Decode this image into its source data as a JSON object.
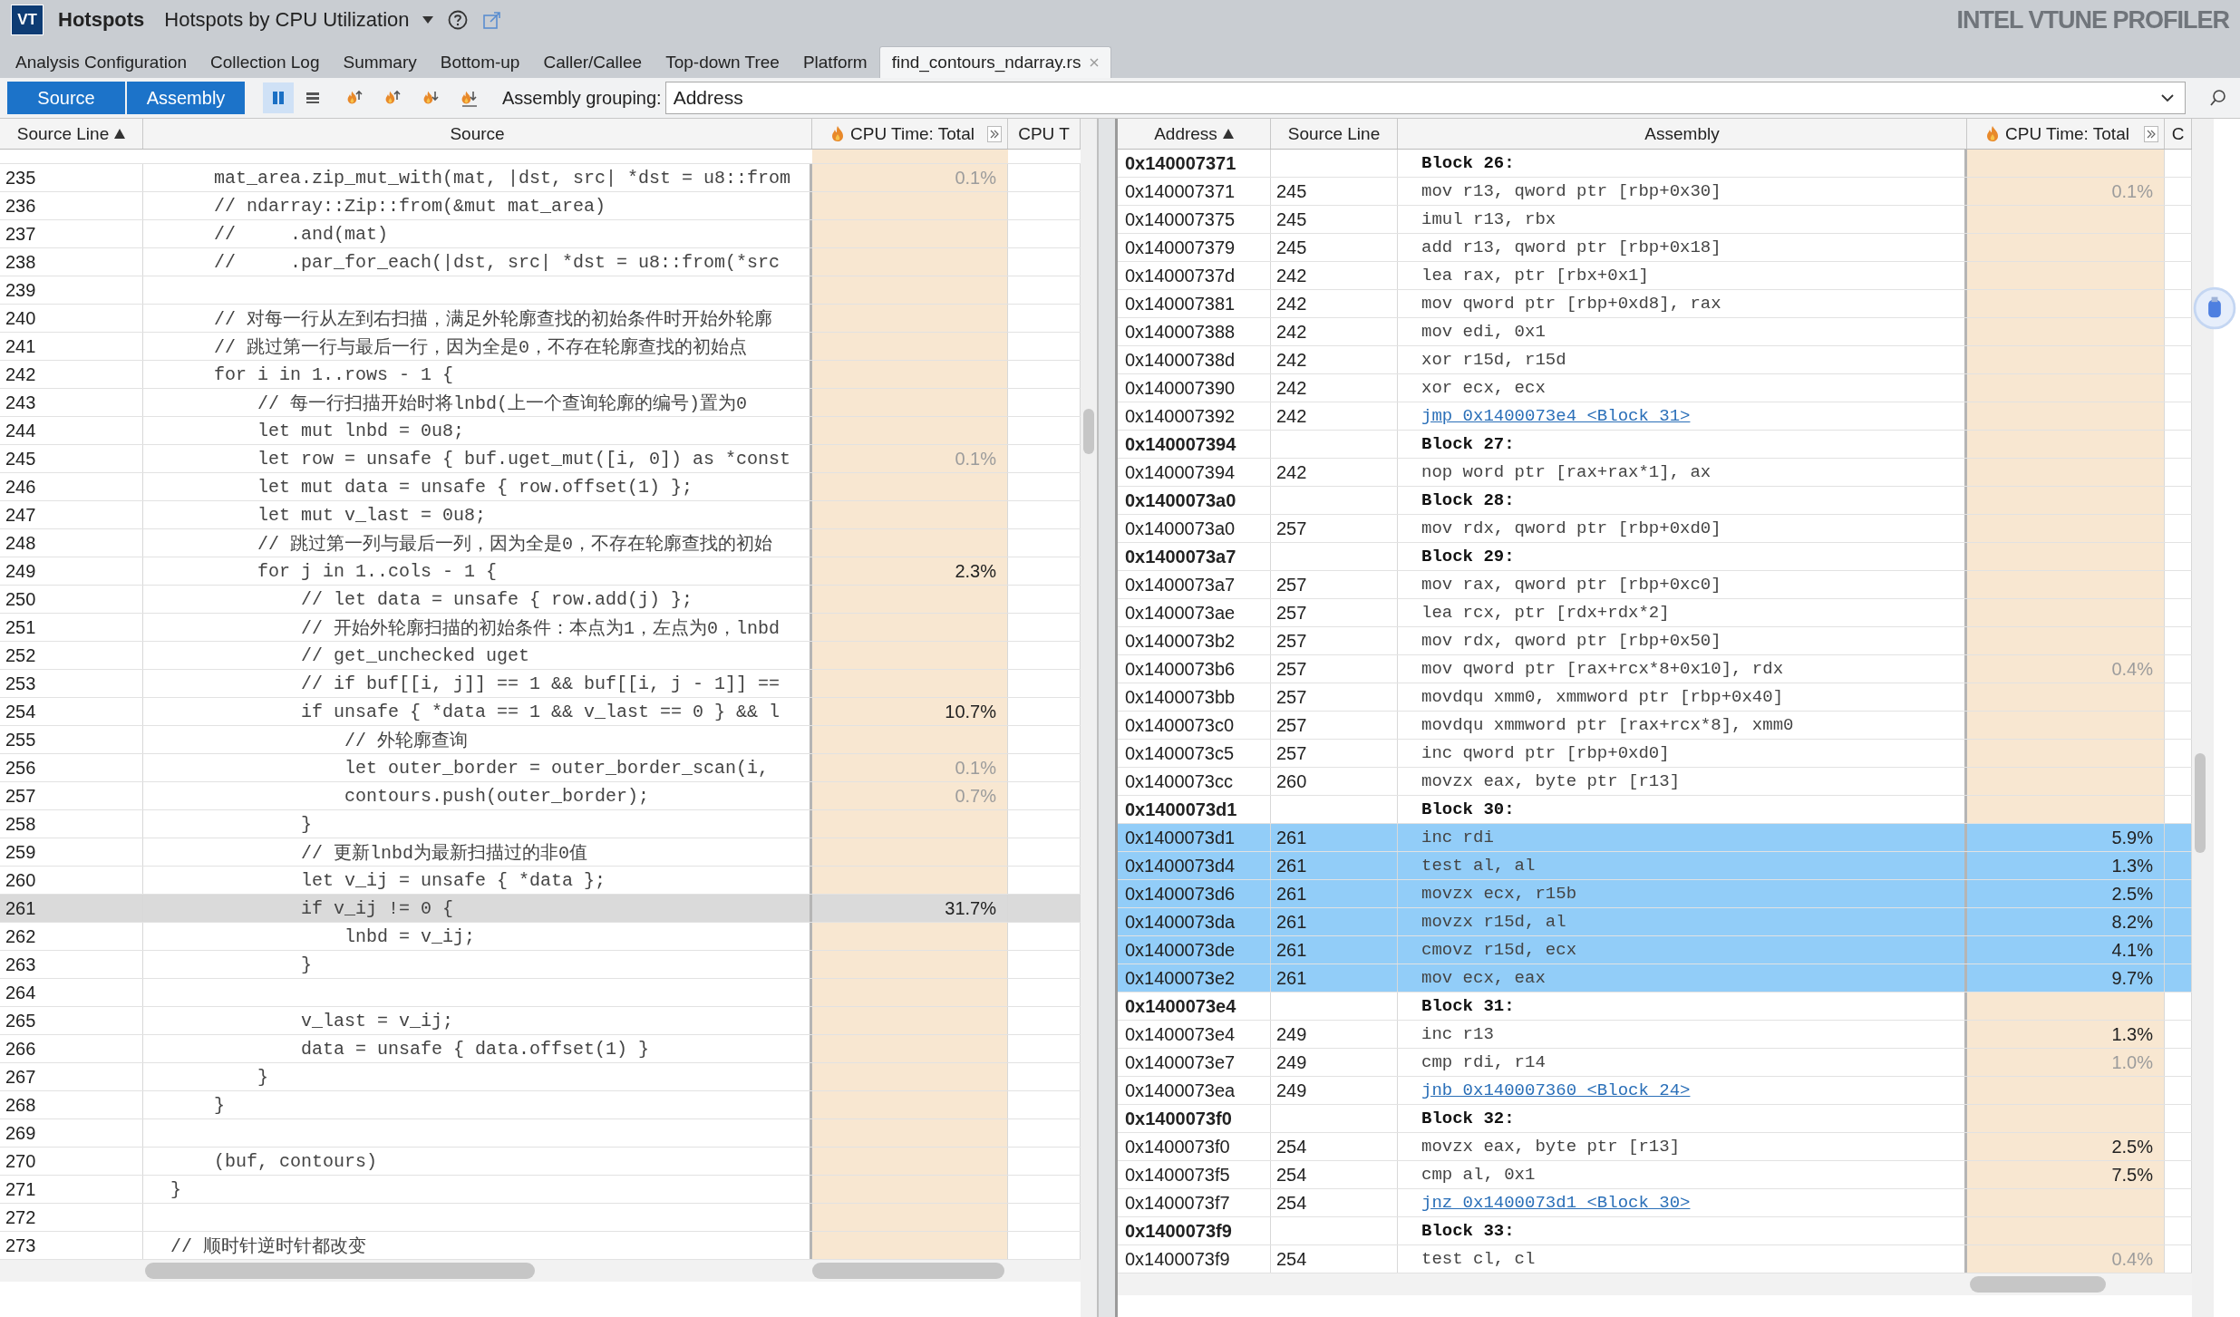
{
  "app": {
    "logo": "VT",
    "name": "Hotspots",
    "viewpoint": "Hotspots by CPU Utilization",
    "brand": "INTEL VTUNE PROFILER"
  },
  "tabs": [
    {
      "label": "Analysis Configuration",
      "selected": false,
      "closable": false
    },
    {
      "label": "Collection Log",
      "selected": false,
      "closable": false
    },
    {
      "label": "Summary",
      "selected": false,
      "closable": false
    },
    {
      "label": "Bottom-up",
      "selected": false,
      "closable": false
    },
    {
      "label": "Caller/Callee",
      "selected": false,
      "closable": false
    },
    {
      "label": "Top-down Tree",
      "selected": false,
      "closable": false
    },
    {
      "label": "Platform",
      "selected": false,
      "closable": false
    },
    {
      "label": "find_contours_ndarray.rs",
      "selected": true,
      "closable": true
    }
  ],
  "toolbar": {
    "views": [
      {
        "label": "Source",
        "selected": true
      },
      {
        "label": "Assembly",
        "selected": true
      }
    ],
    "layout_toggles": [
      {
        "kind": "columns",
        "selected": true
      },
      {
        "kind": "rows",
        "selected": false
      }
    ],
    "grouping": {
      "label": "Assembly grouping:",
      "value": "Address"
    }
  },
  "source_pane": {
    "columns": [
      {
        "label": "Source Line",
        "sorted": true,
        "kind": "plain"
      },
      {
        "label": "Source",
        "sorted": false,
        "kind": "plain"
      },
      {
        "label": "CPU Time: Total",
        "sorted": false,
        "kind": "metric"
      },
      {
        "label": "CPU T",
        "sorted": false,
        "kind": "plain"
      }
    ],
    "rows": [
      {
        "line": "235",
        "code": "    mat_area.zip_mut_with(mat, |dst, src| *dst = u8::from",
        "cpu": "0.1%",
        "faint": true,
        "selected": false
      },
      {
        "line": "236",
        "code": "    // ndarray::Zip::from(&mut mat_area)",
        "selected": false
      },
      {
        "line": "237",
        "code": "    //     .and(mat)",
        "selected": false
      },
      {
        "line": "238",
        "code": "    //     .par_for_each(|dst, src| *dst = u8::from(*src",
        "selected": false
      },
      {
        "line": "239",
        "selected": false
      },
      {
        "line": "240",
        "code": "    // 对每一行从左到右扫描，满足外轮廓查找的初始条件时开始外轮廓",
        "selected": false
      },
      {
        "line": "241",
        "code": "    // 跳过第一行与最后一行，因为全是0，不存在轮廓查找的初始点",
        "selected": false
      },
      {
        "line": "242",
        "code": "    for i in 1..rows - 1 {",
        "selected": false
      },
      {
        "line": "243",
        "code": "        // 每一行扫描开始时将lnbd(上一个查询轮廓的编号)置为0",
        "selected": false
      },
      {
        "line": "244",
        "code": "        let mut lnbd = 0u8;",
        "selected": false
      },
      {
        "line": "245",
        "code": "        let row = unsafe { buf.uget_mut([i, 0]) as *const",
        "cpu": "0.1%",
        "faint": true,
        "selected": false
      },
      {
        "line": "246",
        "code": "        let mut data = unsafe { row.offset(1) };",
        "selected": false
      },
      {
        "line": "247",
        "code": "        let mut v_last = 0u8;",
        "selected": false
      },
      {
        "line": "248",
        "code": "        // 跳过第一列与最后一列，因为全是0，不存在轮廓查找的初始",
        "selected": false
      },
      {
        "line": "249",
        "code": "        for j in 1..cols - 1 {",
        "cpu": "2.3%",
        "faint": false,
        "selected": false
      },
      {
        "line": "250",
        "code": "            // let data = unsafe { row.add(j) };",
        "selected": false
      },
      {
        "line": "251",
        "code": "            // 开始外轮廓扫描的初始条件：本点为1，左点为0，lnbd",
        "selected": false
      },
      {
        "line": "252",
        "code": "            // get_unchecked uget",
        "selected": false
      },
      {
        "line": "253",
        "code": "            // if buf[[i, j]] == 1 && buf[[i, j - 1]] ==",
        "selected": false
      },
      {
        "line": "254",
        "code": "            if unsafe { *data == 1 && v_last == 0 } && l",
        "cpu": "10.7%",
        "faint": false,
        "selected": false
      },
      {
        "line": "255",
        "code": "                // 外轮廓查询",
        "selected": false
      },
      {
        "line": "256",
        "code": "                let outer_border = outer_border_scan(i,",
        "cpu": "0.1%",
        "faint": true,
        "selected": false
      },
      {
        "line": "257",
        "code": "                contours.push(outer_border);",
        "cpu": "0.7%",
        "faint": true,
        "selected": false
      },
      {
        "line": "258",
        "code": "            }",
        "selected": false
      },
      {
        "line": "259",
        "code": "            // 更新lnbd为最新扫描过的非0值",
        "selected": false
      },
      {
        "line": "260",
        "code": "            let v_ij = unsafe { *data };",
        "selected": false
      },
      {
        "line": "261",
        "code": "            if v_ij != 0 {",
        "cpu": "31.7%",
        "faint": false,
        "selected": true
      },
      {
        "line": "262",
        "code": "                lnbd = v_ij;",
        "selected": false
      },
      {
        "line": "263",
        "code": "            }",
        "selected": false
      },
      {
        "line": "264",
        "selected": false
      },
      {
        "line": "265",
        "code": "            v_last = v_ij;",
        "selected": false
      },
      {
        "line": "266",
        "code": "            data = unsafe { data.offset(1) }",
        "selected": false
      },
      {
        "line": "267",
        "code": "        }",
        "selected": false
      },
      {
        "line": "268",
        "code": "    }",
        "selected": false
      },
      {
        "line": "269",
        "selected": false
      },
      {
        "line": "270",
        "code": "    (buf, contours)",
        "selected": false
      },
      {
        "line": "271",
        "code": "}",
        "selected": false
      },
      {
        "line": "272",
        "selected": false
      },
      {
        "line": "273",
        "code": "// 顺时针逆时针都改变",
        "selected": false
      }
    ]
  },
  "assembly_pane": {
    "columns": [
      {
        "label": "Address",
        "sorted": true,
        "kind": "plain"
      },
      {
        "label": "Source Line",
        "sorted": false,
        "kind": "plain"
      },
      {
        "label": "Assembly",
        "sorted": false,
        "kind": "plain"
      },
      {
        "label": "CPU Time: Total",
        "sorted": false,
        "kind": "metric"
      },
      {
        "label": "C",
        "sorted": false,
        "kind": "plain"
      }
    ],
    "rows": [
      {
        "kind": "block",
        "address": "0x140007371",
        "assembly": "Block 26:",
        "selected": false
      },
      {
        "kind": "instr",
        "address": "0x140007371",
        "line": "245",
        "assembly": "mov r13, qword ptr [rbp+0x30]",
        "cpu": "0.1%",
        "faint": true,
        "selected": false
      },
      {
        "kind": "instr",
        "address": "0x140007375",
        "line": "245",
        "assembly": "imul r13, rbx",
        "selected": false
      },
      {
        "kind": "instr",
        "address": "0x140007379",
        "line": "245",
        "assembly": "add r13, qword ptr [rbp+0x18]",
        "selected": false
      },
      {
        "kind": "instr",
        "address": "0x14000737d",
        "line": "242",
        "assembly": "lea rax, ptr [rbx+0x1]",
        "selected": false
      },
      {
        "kind": "instr",
        "address": "0x140007381",
        "line": "242",
        "assembly": "mov qword ptr [rbp+0xd8], rax",
        "selected": false
      },
      {
        "kind": "instr",
        "address": "0x140007388",
        "line": "242",
        "assembly": "mov edi, 0x1",
        "selected": false
      },
      {
        "kind": "instr",
        "address": "0x14000738d",
        "line": "242",
        "assembly": "xor r15d, r15d",
        "selected": false
      },
      {
        "kind": "instr",
        "address": "0x140007390",
        "line": "242",
        "assembly": "xor ecx, ecx",
        "selected": false
      },
      {
        "kind": "jump",
        "address": "0x140007392",
        "line": "242",
        "assembly": "jmp 0x1400073e4 <Block 31>",
        "selected": false
      },
      {
        "kind": "block",
        "address": "0x140007394",
        "assembly": "Block 27:",
        "selected": false
      },
      {
        "kind": "instr",
        "address": "0x140007394",
        "line": "242",
        "assembly": "nop word ptr [rax+rax*1], ax",
        "selected": false
      },
      {
        "kind": "block",
        "address": "0x1400073a0",
        "assembly": "Block 28:",
        "selected": false
      },
      {
        "kind": "instr",
        "address": "0x1400073a0",
        "line": "257",
        "assembly": "mov rdx, qword ptr [rbp+0xd0]",
        "selected": false
      },
      {
        "kind": "block",
        "address": "0x1400073a7",
        "assembly": "Block 29:",
        "selected": false
      },
      {
        "kind": "instr",
        "address": "0x1400073a7",
        "line": "257",
        "assembly": "mov rax, qword ptr [rbp+0xc0]",
        "selected": false
      },
      {
        "kind": "instr",
        "address": "0x1400073ae",
        "line": "257",
        "assembly": "lea rcx, ptr [rdx+rdx*2]",
        "selected": false
      },
      {
        "kind": "instr",
        "address": "0x1400073b2",
        "line": "257",
        "assembly": "mov rdx, qword ptr [rbp+0x50]",
        "selected": false
      },
      {
        "kind": "instr",
        "address": "0x1400073b6",
        "line": "257",
        "assembly": "mov qword ptr [rax+rcx*8+0x10], rdx",
        "cpu": "0.4%",
        "faint": true,
        "selected": false
      },
      {
        "kind": "instr",
        "address": "0x1400073bb",
        "line": "257",
        "assembly": "movdqu xmm0, xmmword ptr [rbp+0x40]",
        "selected": false
      },
      {
        "kind": "instr",
        "address": "0x1400073c0",
        "line": "257",
        "assembly": "movdqu xmmword ptr [rax+rcx*8], xmm0",
        "selected": false
      },
      {
        "kind": "instr",
        "address": "0x1400073c5",
        "line": "257",
        "assembly": "inc qword ptr [rbp+0xd0]",
        "selected": false
      },
      {
        "kind": "instr",
        "address": "0x1400073cc",
        "line": "260",
        "assembly": "movzx eax, byte ptr [r13]",
        "selected": false
      },
      {
        "kind": "block",
        "address": "0x1400073d1",
        "assembly": "Block 30:",
        "selected": false
      },
      {
        "kind": "instr",
        "address": "0x1400073d1",
        "line": "261",
        "assembly": "inc rdi",
        "cpu": "5.9%",
        "faint": false,
        "selected": true
      },
      {
        "kind": "instr",
        "address": "0x1400073d4",
        "line": "261",
        "assembly": "test al, al",
        "cpu": "1.3%",
        "faint": false,
        "selected": true
      },
      {
        "kind": "instr",
        "address": "0x1400073d6",
        "line": "261",
        "assembly": "movzx ecx, r15b",
        "cpu": "2.5%",
        "faint": false,
        "selected": true
      },
      {
        "kind": "instr",
        "address": "0x1400073da",
        "line": "261",
        "assembly": "movzx r15d, al",
        "cpu": "8.2%",
        "faint": false,
        "selected": true
      },
      {
        "kind": "instr",
        "address": "0x1400073de",
        "line": "261",
        "assembly": "cmovz r15d, ecx",
        "cpu": "4.1%",
        "faint": false,
        "selected": true
      },
      {
        "kind": "instr",
        "address": "0x1400073e2",
        "line": "261",
        "assembly": "mov ecx, eax",
        "cpu": "9.7%",
        "faint": false,
        "selected": true
      },
      {
        "kind": "block",
        "address": "0x1400073e4",
        "assembly": "Block 31:",
        "selected": false
      },
      {
        "kind": "instr",
        "address": "0x1400073e4",
        "line": "249",
        "assembly": "inc r13",
        "cpu": "1.3%",
        "faint": false,
        "selected": false
      },
      {
        "kind": "instr",
        "address": "0x1400073e7",
        "line": "249",
        "assembly": "cmp rdi, r14",
        "cpu": "1.0%",
        "faint": true,
        "selected": false
      },
      {
        "kind": "jump",
        "address": "0x1400073ea",
        "line": "249",
        "assembly": "jnb 0x140007360 <Block 24>",
        "selected": false
      },
      {
        "kind": "block",
        "address": "0x1400073f0",
        "assembly": "Block 32:",
        "selected": false
      },
      {
        "kind": "instr",
        "address": "0x1400073f0",
        "line": "254",
        "assembly": "movzx eax, byte ptr [r13]",
        "cpu": "2.5%",
        "faint": false,
        "selected": false
      },
      {
        "kind": "instr",
        "address": "0x1400073f5",
        "line": "254",
        "assembly": "cmp al, 0x1",
        "cpu": "7.5%",
        "faint": false,
        "selected": false
      },
      {
        "kind": "jump",
        "address": "0x1400073f7",
        "line": "254",
        "assembly": "jnz 0x1400073d1 <Block 30>",
        "selected": false
      },
      {
        "kind": "block",
        "address": "0x1400073f9",
        "assembly": "Block 33:",
        "selected": false
      },
      {
        "kind": "instr",
        "address": "0x1400073f9",
        "line": "254",
        "assembly": "test cl, cl",
        "cpu": "0.4%",
        "faint": true,
        "selected": false
      }
    ]
  }
}
